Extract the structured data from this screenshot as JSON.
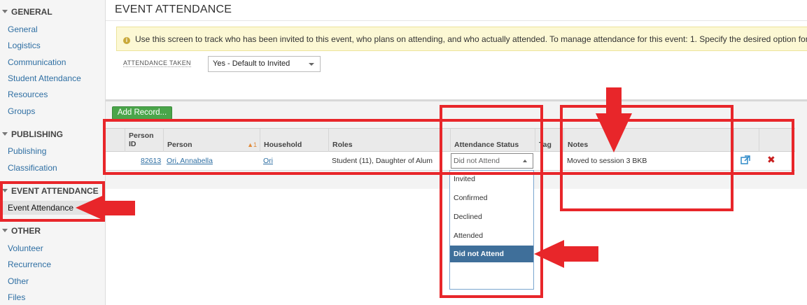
{
  "sidebar": {
    "sections": [
      {
        "title": "GENERAL",
        "items": [
          "General",
          "Logistics",
          "Communication",
          "Student Attendance",
          "Resources",
          "Groups"
        ]
      },
      {
        "title": "PUBLISHING",
        "items": [
          "Publishing",
          "Classification"
        ]
      },
      {
        "title": "EVENT ATTENDANCE",
        "items": [
          "Event Attendance"
        ]
      },
      {
        "title": "OTHER",
        "items": [
          "Volunteer",
          "Recurrence",
          "Other",
          "Files"
        ]
      }
    ],
    "active_item": "Event Attendance"
  },
  "page": {
    "title": "EVENT ATTENDANCE",
    "info_text": "Use this screen to track who has been invited to this event, who plans on attending, and who actually attended. To manage attendance for this event: 1. Specify the desired option for \"A",
    "attendance_taken_label": "ATTENDANCE TAKEN",
    "attendance_taken_value": "Yes - Default to Invited",
    "add_record_label": "Add Record..."
  },
  "table": {
    "columns": [
      "Person ID",
      "Person",
      "Household",
      "Roles",
      "Attendance Status",
      "Tag",
      "Notes"
    ],
    "person_id_line1": "Person",
    "person_id_line2": "ID",
    "sort_indicator": "1",
    "rows": [
      {
        "person_id": "82613",
        "person": "Ori, Annabella",
        "household": "Ori",
        "roles": "Student (11), Daughter of Alum",
        "attendance_status": "Did not Attend",
        "tag": "",
        "notes": "Moved to session 3 BKB"
      }
    ]
  },
  "status_dropdown": {
    "options": [
      "Invited",
      "Confirmed",
      "Declined",
      "Attended",
      "Did not Attend"
    ],
    "selected": "Did not Attend"
  },
  "colors": {
    "annotation": "#e8262a",
    "accent": "#2f6fa3",
    "add_button": "#4aa54a",
    "selected_option": "#3f6f9a"
  },
  "icons": [
    "open-external-icon",
    "delete-x-icon",
    "info-icon",
    "collapse-triangle-icon",
    "sort-asc-icon"
  ]
}
